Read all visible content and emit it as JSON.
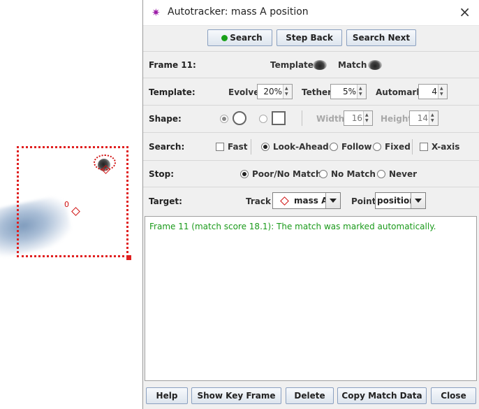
{
  "video": {
    "origin_label": "0"
  },
  "titlebar": {
    "title": "Autotracker: mass A position",
    "app_icon": "sparkle-icon",
    "close_icon": "×"
  },
  "toolbar": {
    "search_label": "Search",
    "step_back_label": "Step Back",
    "search_next_label": "Search Next"
  },
  "frame_row": {
    "frame_label": "Frame 11:",
    "template_label": "Template",
    "match_label": "Match"
  },
  "template_row": {
    "label": "Template:",
    "evolve_label": "Evolve",
    "evolve_value": "20%",
    "tether_label": "Tether",
    "tether_value": "5%",
    "automark_label": "Automark",
    "automark_value": "4"
  },
  "shape_row": {
    "label": "Shape:",
    "selected_shape": "circle",
    "width_label": "Width",
    "width_value": "16",
    "height_label": "Height",
    "height_value": "14"
  },
  "search_row": {
    "label": "Search:",
    "fast_label": "Fast",
    "fast_checked": false,
    "lookahead_label": "Look-Ahead",
    "follow_label": "Follow",
    "fixed_label": "Fixed",
    "selected_mode": "Look-Ahead",
    "xaxis_label": "X-axis",
    "xaxis_checked": false
  },
  "stop_row": {
    "label": "Stop:",
    "poor_label": "Poor/No Match",
    "nomatch_label": "No Match",
    "never_label": "Never",
    "selected": "Poor/No Match"
  },
  "target_row": {
    "label": "Target:",
    "track_label": "Track",
    "track_value": "mass A",
    "point_label": "Point",
    "point_value": "position"
  },
  "message": {
    "text": "Frame 11 (match score 18.1): The match was marked automatically.",
    "color": "#1a9a1a"
  },
  "bottom": {
    "help_label": "Help",
    "show_key_frame_label": "Show Key Frame",
    "delete_label": "Delete",
    "copy_match_data_label": "Copy Match Data",
    "close_label": "Close"
  },
  "colors": {
    "accent_red": "#e02020",
    "status_green": "#19a019",
    "title_icon": "#9c1fa8"
  }
}
